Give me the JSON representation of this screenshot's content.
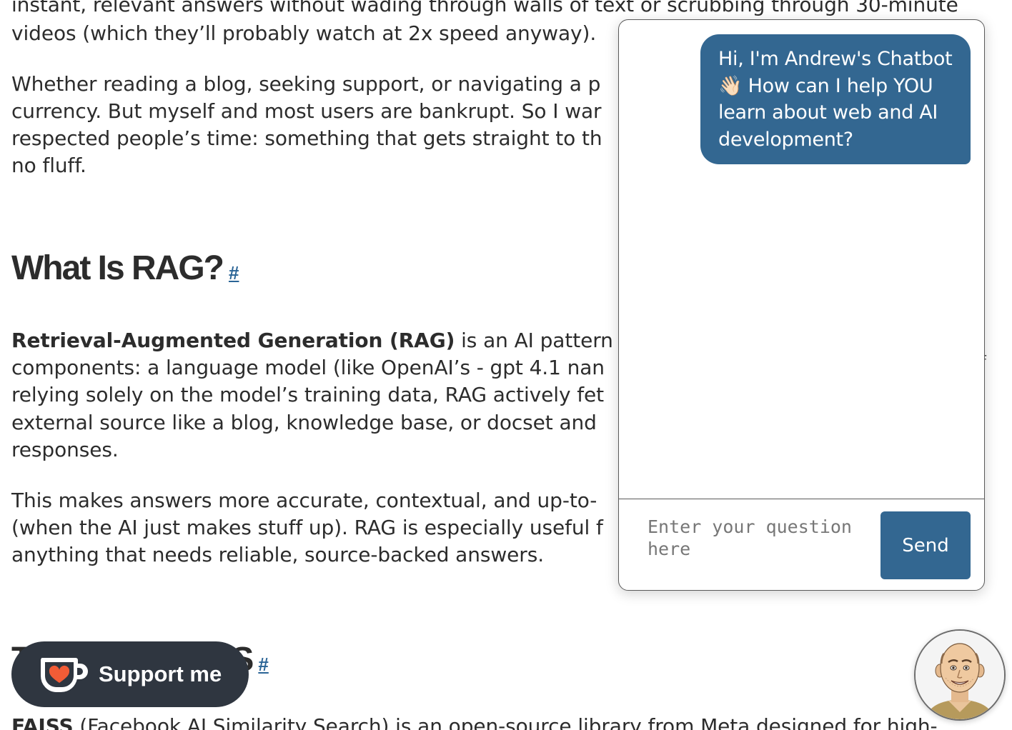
{
  "article": {
    "paragraph1": [
      "instant, relevant answers without wading through walls of text or scrubbing through 30-minute",
      "videos (which they’ll probably watch at 2x speed anyway)."
    ],
    "paragraph2": [
      "Whether reading a blog, seeking support, or navigating a p",
      "currency. But myself and most users are bankrupt. So I war",
      "respected people’s time: something that gets straight to th",
      "no fluff."
    ],
    "heading1": "What Is RAG?",
    "heading_anchor": "#",
    "paragraph3_bold": "Retrieval-Augmented Generation (RAG)",
    "paragraph3_first_rest": " is an AI pattern t",
    "paragraph3": [
      "components: a language model (like OpenAI’s - gpt 4.1 nan",
      "relying solely on the model’s training data, RAG actively fet",
      "external source like a blog, knowledge base, or docset and",
      "responses."
    ],
    "paragraph4": [
      "This makes answers more accurate, contextual, and up-to-",
      "(when the AI just makes stuff up). RAG is especially useful f",
      "anything that needs reliable, source-backed answers."
    ],
    "heading2_visible": "SS",
    "heading2_prefix": "T",
    "stray_char": "f",
    "paragraph5_bold": "FAISS",
    "paragraph5_rest": " (Facebook AI Similarity Search) is an open-source library from Meta designed for high-"
  },
  "chat": {
    "greeting": "Hi, I'm Andrew's Chatbot 👋🏻 How can I help YOU learn about web and AI development?",
    "input_placeholder": "Enter your question here",
    "input_value": "",
    "send_label": "Send",
    "accent_color": "#336791"
  },
  "support": {
    "label": "Support me",
    "icon": "kofi-cup-heart-icon",
    "heart_color": "#f25c36"
  },
  "avatar": {
    "icon": "chatbot-avatar-icon"
  }
}
